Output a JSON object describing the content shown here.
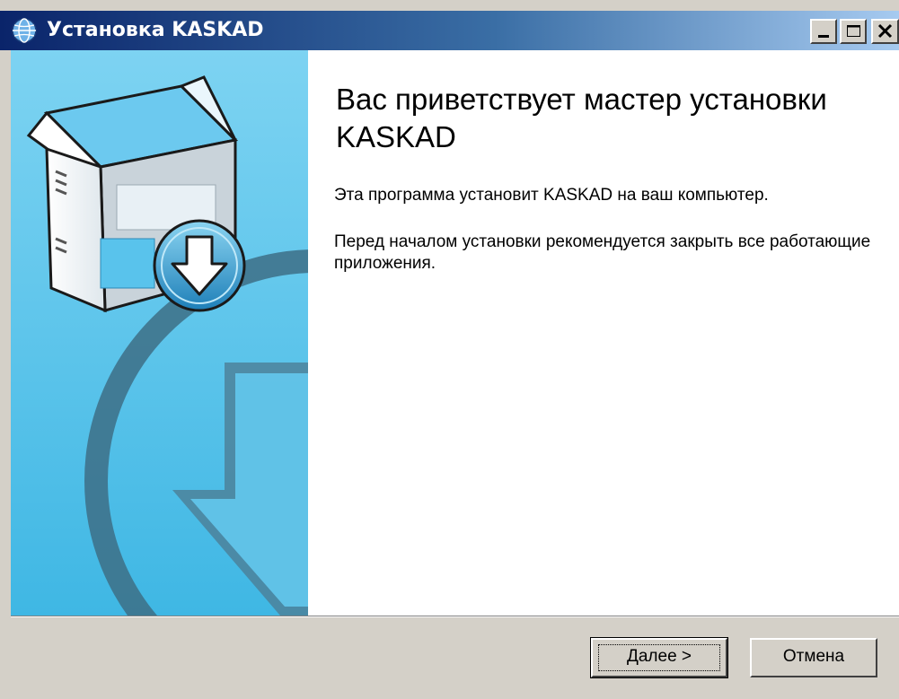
{
  "window": {
    "title": "Установка KASKAD",
    "title_icon": "globe-icon",
    "controls": {
      "minimize": "minimize-icon",
      "maximize": "maximize-icon",
      "close": "close-icon"
    }
  },
  "main": {
    "heading": "Вас приветствует мастер установки KASKAD",
    "intro": "Эта программа установит KASKAD на ваш компьютер.",
    "advice": "Перед началом установки рекомендуется закрыть все работающие приложения."
  },
  "buttons": {
    "next_accel": "Д",
    "next_rest": "алее >",
    "cancel": "Отмена"
  },
  "colors": {
    "titlebar_start": "#0a246a",
    "titlebar_end": "#a6caf0",
    "side_panel": "#4fc1ea"
  }
}
